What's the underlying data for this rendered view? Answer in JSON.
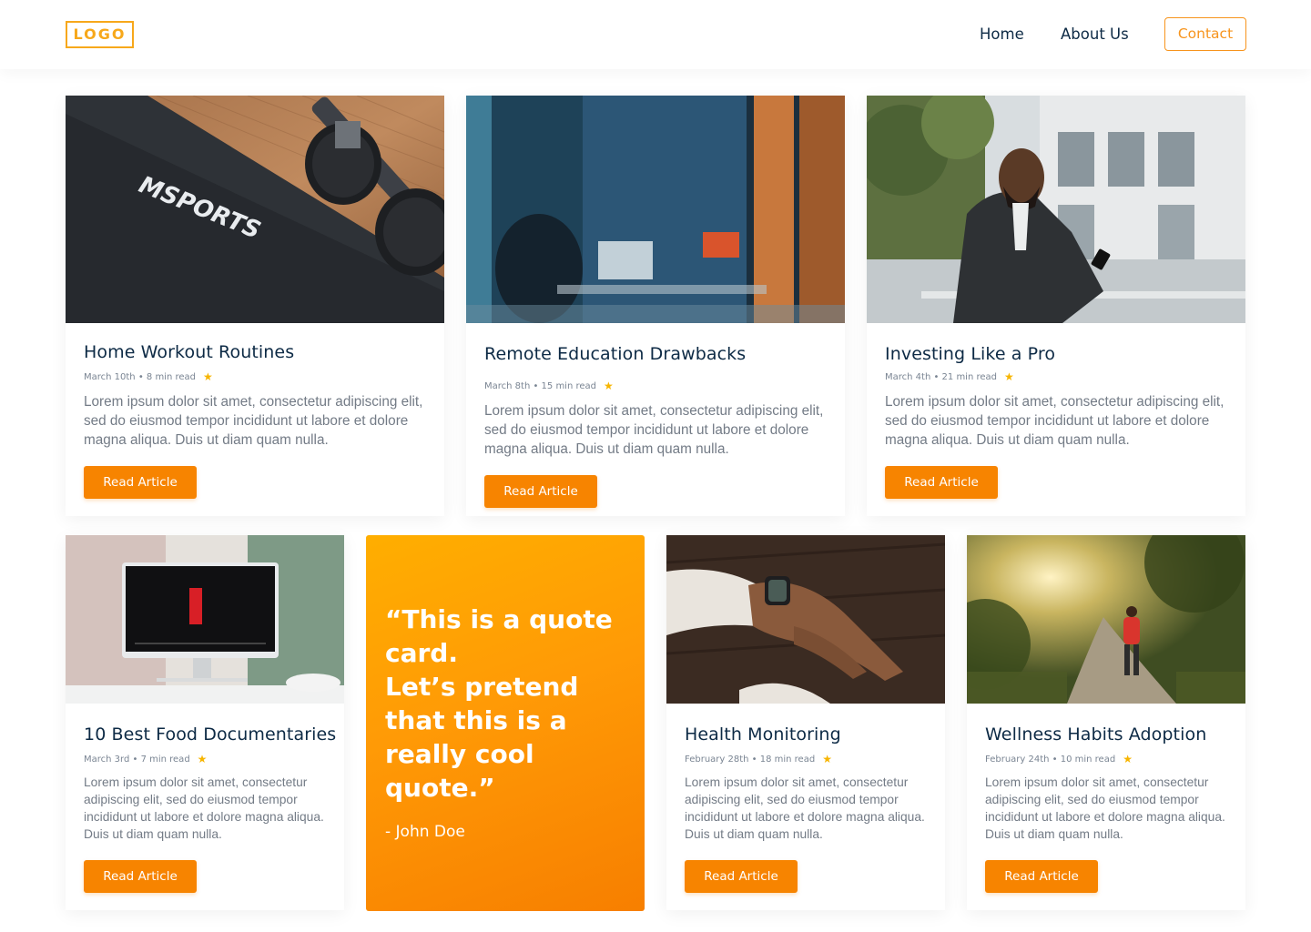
{
  "header": {
    "logo": "LOGO",
    "nav": [
      {
        "label": "Home"
      },
      {
        "label": "About Us"
      }
    ],
    "contact_label": "Contact"
  },
  "articles": [
    {
      "title": "Home Workout Routines",
      "meta": "March 10th • 8 min read",
      "body": "Lorem ipsum dolor sit amet, consectetur adipiscing elit, sed do eiusmod tempor incididunt ut labore et dolore magna aliqua. Duis ut diam quam nulla.",
      "button": "Read Article",
      "image": "dumbbell-sports-mat-photo"
    },
    {
      "title": "Remote Education Drawbacks",
      "meta": "March 8th • 15 min read",
      "body": "Lorem ipsum dolor sit amet, consectetur adipiscing elit, sed do eiusmod tempor incididunt ut labore et dolore magna aliqua. Duis ut diam quam nulla.",
      "button": "Read Article",
      "image": "person-laptop-cafe-window-photo"
    },
    {
      "title": "Investing Like a Pro",
      "meta": "March 4th • 21 min read",
      "body": "Lorem ipsum dolor sit amet, consectetur adipiscing elit, sed do eiusmod tempor incididunt ut labore et dolore magna aliqua. Duis ut diam quam nulla.",
      "button": "Read Article",
      "image": "businessman-phone-outdoor-photo"
    },
    {
      "title": "10 Best Food Documentaries",
      "meta": "March 3rd • 7 min read",
      "body": "Lorem ipsum dolor sit amet, consectetur adipiscing elit, sed do eiusmod tempor incididunt ut labore et dolore magna aliqua. Duis ut diam quam nulla.",
      "button": "Read Article",
      "image": "netflix-computer-screen-photo"
    },
    {
      "title": "Health Monitoring",
      "meta": "February 28th • 18 min read",
      "body": "Lorem ipsum dolor sit amet, consectetur adipiscing elit, sed do eiusmod tempor incididunt ut labore et dolore magna aliqua. Duis ut diam quam nulla.",
      "button": "Read Article",
      "image": "smartwatch-wrist-photo"
    },
    {
      "title": "Wellness Habits Adoption",
      "meta": "February 24th • 10 min read",
      "body": "Lorem ipsum dolor sit amet, consectetur adipiscing elit, sed do eiusmod tempor incididunt ut labore et dolore magna aliqua. Duis ut diam quam nulla.",
      "button": "Read Article",
      "image": "runner-forest-path-photo"
    }
  ],
  "quote": {
    "line1": "“This is a quote card.",
    "line2": "Let’s pretend that this is a really cool quote.”",
    "author": "- John Doe"
  },
  "colors": {
    "accent": "#f78400",
    "logo": "#f7a81b",
    "heading": "#0d2a45",
    "star": "#f7b500"
  }
}
